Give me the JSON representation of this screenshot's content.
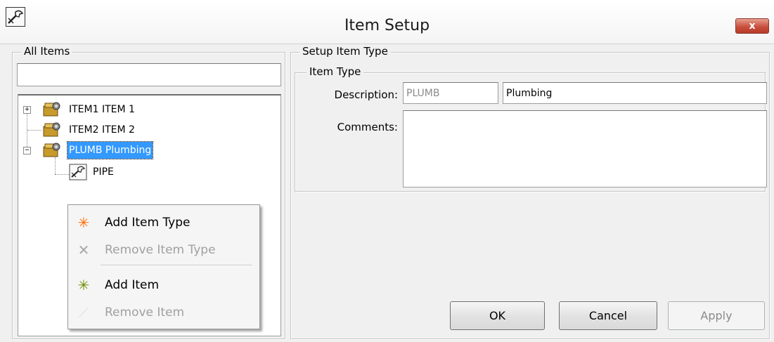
{
  "window": {
    "title": "Item Setup",
    "close_label": "x"
  },
  "all_items": {
    "frame_label": "All Items",
    "search_value": "",
    "tree": [
      {
        "label": "ITEM1 ITEM 1",
        "expander": "+",
        "icon": "folder-gear-icon",
        "selected": false
      },
      {
        "label": "ITEM2 ITEM 2",
        "expander": "",
        "icon": "folder-gear-icon",
        "selected": false
      },
      {
        "label": "PLUMB Plumbing",
        "expander": "−",
        "icon": "folder-gear-icon",
        "selected": true
      },
      {
        "label": "PIPE",
        "expander": "",
        "icon": "wrench-icon",
        "selected": false
      }
    ]
  },
  "context_menu": {
    "items": [
      {
        "label": "Add Item Type",
        "icon": "asterisk-orange-icon",
        "enabled": true
      },
      {
        "label": "Remove Item Type",
        "icon": "x-gray-icon",
        "enabled": false
      },
      {
        "label": "Add Item",
        "icon": "asterisk-green-icon",
        "enabled": true
      },
      {
        "label": "Remove Item",
        "icon": "remove-item-icon",
        "enabled": false
      }
    ]
  },
  "setup": {
    "frame_label": "Setup Item Type",
    "item_type_label": "Item Type",
    "description_label": "Description:",
    "code_value": "PLUMB",
    "description_value": "Plumbing",
    "comments_label": "Comments:",
    "comments_value": ""
  },
  "buttons": {
    "ok": "OK",
    "cancel": "Cancel",
    "apply": "Apply"
  },
  "colors": {
    "selection": "#3399ff",
    "close_button": "#c9503e",
    "add_item_type_icon": "#ff6a00",
    "add_item_icon": "#6b8e00"
  }
}
